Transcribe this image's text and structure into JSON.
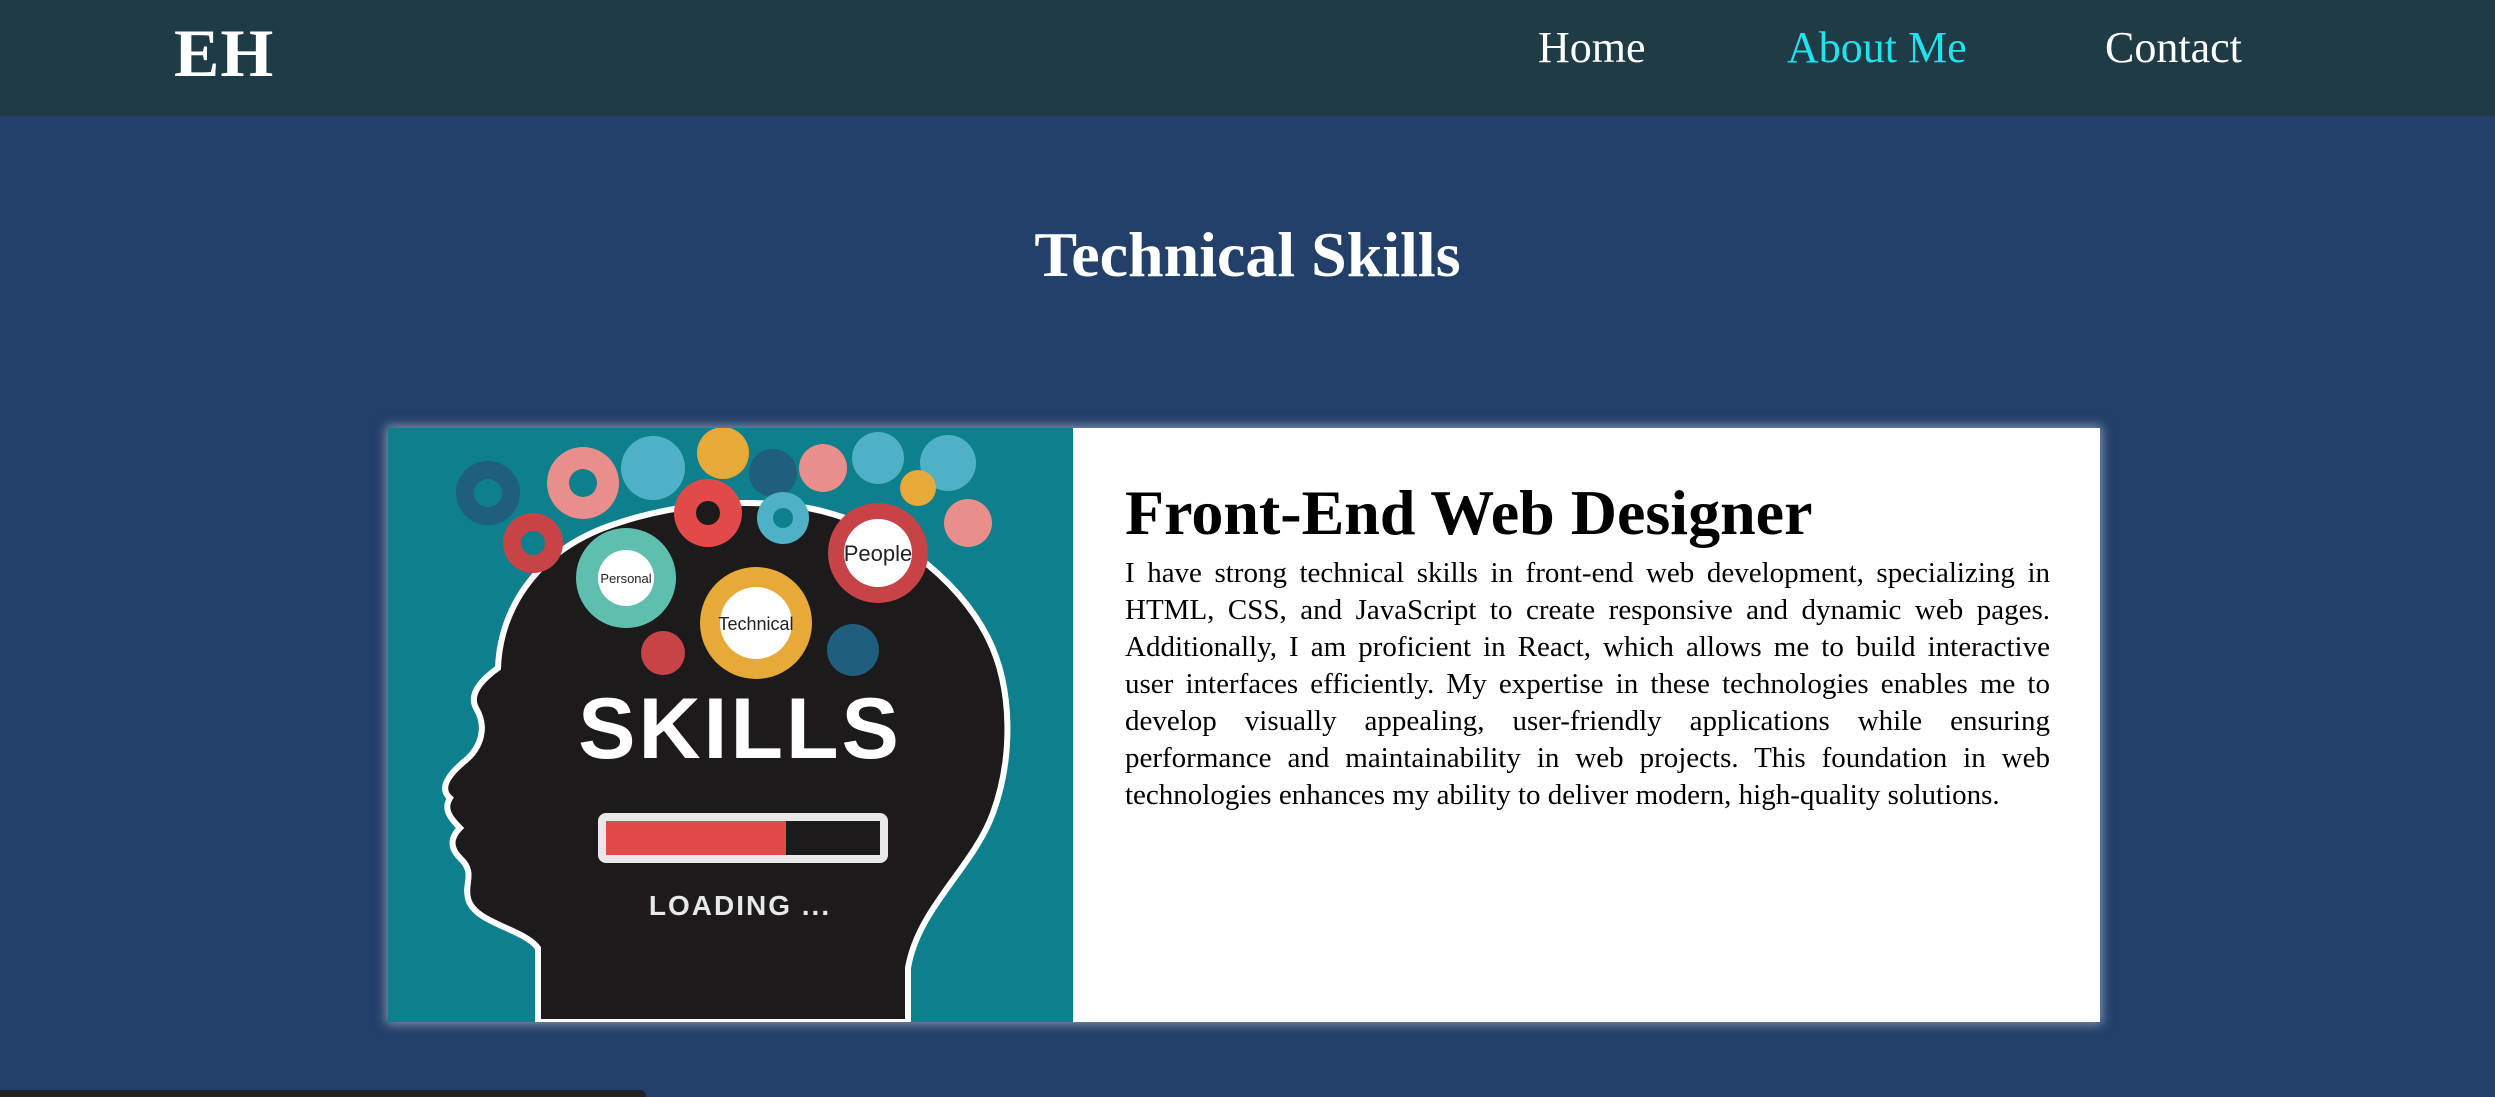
{
  "nav": {
    "logo": "EH",
    "links": [
      {
        "label": "Home",
        "active": false
      },
      {
        "label": "About Me",
        "active": true
      },
      {
        "label": "Contact",
        "active": false
      }
    ]
  },
  "section": {
    "title": "Technical Skills"
  },
  "card": {
    "image": {
      "big_text": "SKILLS",
      "loading_text": "LOADING ...",
      "gear_labels": [
        "Personal",
        "Technical",
        "People"
      ]
    },
    "heading": "Front-End Web Designer",
    "body": "I have strong technical skills in front-end web development, specializing in HTML, CSS, and JavaScript to create responsive and dynamic web pages. Additionally, I am proficient in React, which allows me to build interactive user interfaces efficiently. My expertise in these technologies enables me to develop visually appealing, user-friendly applications while ensuring performance and maintainability in web projects. This foundation in web technologies enhances my ability to deliver modern, high-quality solutions."
  },
  "colors": {
    "navbar_bg": "#1f3b45",
    "page_bg": "#23406a",
    "active_link": "#1fe3ee",
    "image_bg": "#0e7f8c"
  }
}
